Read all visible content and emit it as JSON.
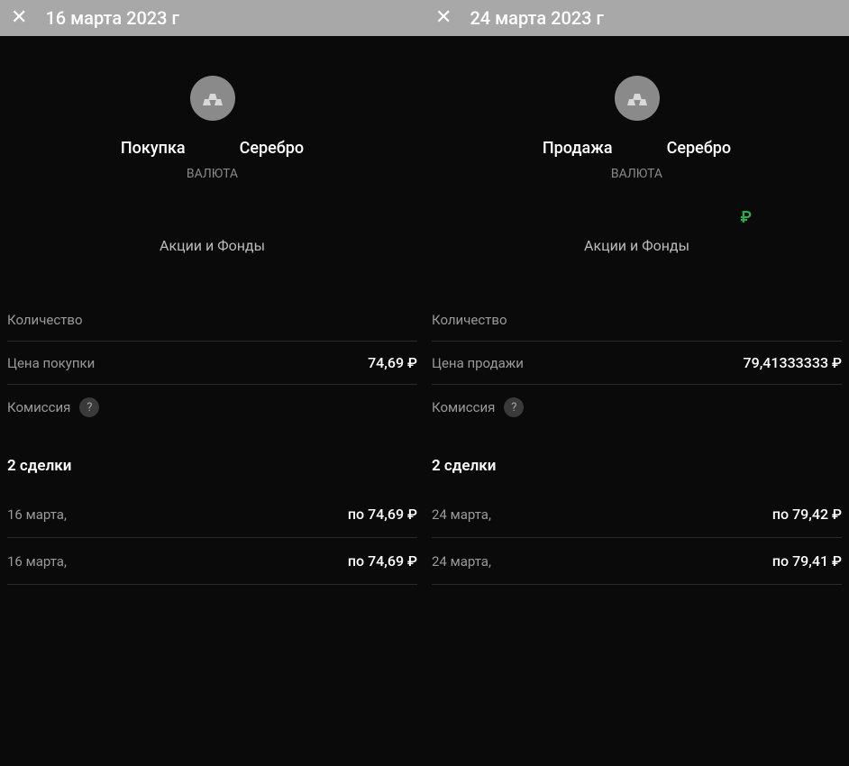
{
  "panels": [
    {
      "header": {
        "title": "16 марта 2023 г"
      },
      "trade_type": "Покупка",
      "metal": "Серебро",
      "currency_label": "ВАЛЮТА",
      "show_ruble": false,
      "ruble_sign": "₽",
      "stocks_label": "Акции и Фонды",
      "quantity_label": "Количество",
      "price_label": "Цена покупки",
      "price_value": "74,69 ₽",
      "commission_label": "Комиссия",
      "help_text": "?",
      "trades_header": "2 сделки",
      "trades": [
        {
          "date": "16 марта,",
          "price": "по 74,69 ₽"
        },
        {
          "date": "16 марта,",
          "price": "по 74,69 ₽"
        }
      ]
    },
    {
      "header": {
        "title": "24 марта 2023 г"
      },
      "trade_type": "Продажа",
      "metal": "Серебро",
      "currency_label": "ВАЛЮТА",
      "show_ruble": true,
      "ruble_sign": "₽",
      "stocks_label": "Акции и Фонды",
      "quantity_label": "Количество",
      "price_label": "Цена продажи",
      "price_value": "79,41333333 ₽",
      "commission_label": "Комиссия",
      "help_text": "?",
      "trades_header": "2 сделки",
      "trades": [
        {
          "date": "24 марта,",
          "price": "по 79,42 ₽"
        },
        {
          "date": "24 марта,",
          "price": "по 79,41 ₽"
        }
      ]
    }
  ]
}
